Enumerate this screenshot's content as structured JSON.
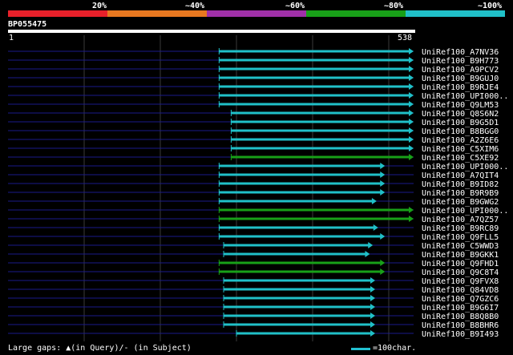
{
  "legend": {
    "labels": [
      "20%",
      "~40%",
      "~60%",
      "~80%",
      "~100%"
    ],
    "colors": [
      "#e8202a",
      "#e87820",
      "#a030a8",
      "#18a018",
      "#20c0c8"
    ]
  },
  "query": {
    "name": "BP055475",
    "start_label": "1",
    "end_label": "538",
    "length": 538
  },
  "hits": [
    {
      "name": "UniRef100_A7NV36",
      "start": 280,
      "end": 538,
      "color": "#20c0c8"
    },
    {
      "name": "UniRef100_B9H773",
      "start": 280,
      "end": 538,
      "color": "#20c0c8"
    },
    {
      "name": "UniRef100_A9PCV2",
      "start": 280,
      "end": 538,
      "color": "#20c0c8"
    },
    {
      "name": "UniRef100_B9GUJ0",
      "start": 280,
      "end": 538,
      "color": "#20c0c8"
    },
    {
      "name": "UniRef100_B9RJE4",
      "start": 280,
      "end": 538,
      "color": "#20c0c8"
    },
    {
      "name": "UniRef100_UPI000..",
      "start": 280,
      "end": 538,
      "color": "#20c0c8"
    },
    {
      "name": "UniRef100_Q9LM53",
      "start": 280,
      "end": 538,
      "color": "#20c0c8"
    },
    {
      "name": "UniRef100_Q8S6N2",
      "start": 296,
      "end": 538,
      "color": "#20c0c8"
    },
    {
      "name": "UniRef100_B9G5D1",
      "start": 296,
      "end": 538,
      "color": "#20c0c8"
    },
    {
      "name": "UniRef100_B8BGG0",
      "start": 296,
      "end": 538,
      "color": "#20c0c8"
    },
    {
      "name": "UniRef100_A2Z6E6",
      "start": 296,
      "end": 538,
      "color": "#20c0c8"
    },
    {
      "name": "UniRef100_C5XIM6",
      "start": 296,
      "end": 538,
      "color": "#20c0c8"
    },
    {
      "name": "UniRef100_C5XE92",
      "start": 296,
      "end": 538,
      "color": "#18a018"
    },
    {
      "name": "UniRef100_UPI000..",
      "start": 280,
      "end": 500,
      "color": "#20c0c8"
    },
    {
      "name": "UniRef100_A7QIT4",
      "start": 280,
      "end": 500,
      "color": "#20c0c8"
    },
    {
      "name": "UniRef100_B9ID82",
      "start": 280,
      "end": 500,
      "color": "#20c0c8"
    },
    {
      "name": "UniRef100_B9R9B9",
      "start": 280,
      "end": 500,
      "color": "#20c0c8"
    },
    {
      "name": "UniRef100_B9GWG2",
      "start": 280,
      "end": 489,
      "color": "#20c0c8"
    },
    {
      "name": "UniRef100_UPI000..",
      "start": 280,
      "end": 538,
      "color": "#18a018"
    },
    {
      "name": "UniRef100_A7QZ57",
      "start": 280,
      "end": 538,
      "color": "#18a018"
    },
    {
      "name": "UniRef100_B9RC89",
      "start": 280,
      "end": 491,
      "color": "#20c0c8"
    },
    {
      "name": "UniRef100_Q9FLL5",
      "start": 280,
      "end": 500,
      "color": "#20c0c8"
    },
    {
      "name": "UniRef100_C5WWD3",
      "start": 286,
      "end": 484,
      "color": "#20c0c8"
    },
    {
      "name": "UniRef100_B9GKK1",
      "start": 286,
      "end": 480,
      "color": "#20c0c8"
    },
    {
      "name": "UniRef100_Q9FHD1",
      "start": 280,
      "end": 500,
      "color": "#18a018"
    },
    {
      "name": "UniRef100_Q9C8T4",
      "start": 280,
      "end": 500,
      "color": "#18a018"
    },
    {
      "name": "UniRef100_Q9FVX8",
      "start": 286,
      "end": 487,
      "color": "#20c0c8"
    },
    {
      "name": "UniRef100_Q84VD8",
      "start": 286,
      "end": 487,
      "color": "#20c0c8"
    },
    {
      "name": "UniRef100_Q7GZC6",
      "start": 286,
      "end": 487,
      "color": "#20c0c8"
    },
    {
      "name": "UniRef100_B9G6I7",
      "start": 286,
      "end": 487,
      "color": "#20c0c8"
    },
    {
      "name": "UniRef100_B8Q8B0",
      "start": 286,
      "end": 487,
      "color": "#20c0c8"
    },
    {
      "name": "UniRef100_B8BHR6",
      "start": 286,
      "end": 487,
      "color": "#20c0c8"
    },
    {
      "name": "UniRef100_B9I493",
      "start": 303,
      "end": 487,
      "color": "#20c0c8"
    }
  ],
  "colors": {
    "background": "#000000",
    "backbone": "#1a1a8a",
    "gridline": "#3a3a3a"
  },
  "footer": {
    "gaps_text": "Large gaps: ▲(in Query)/- (in Subject)",
    "scale_text": "=100char."
  }
}
